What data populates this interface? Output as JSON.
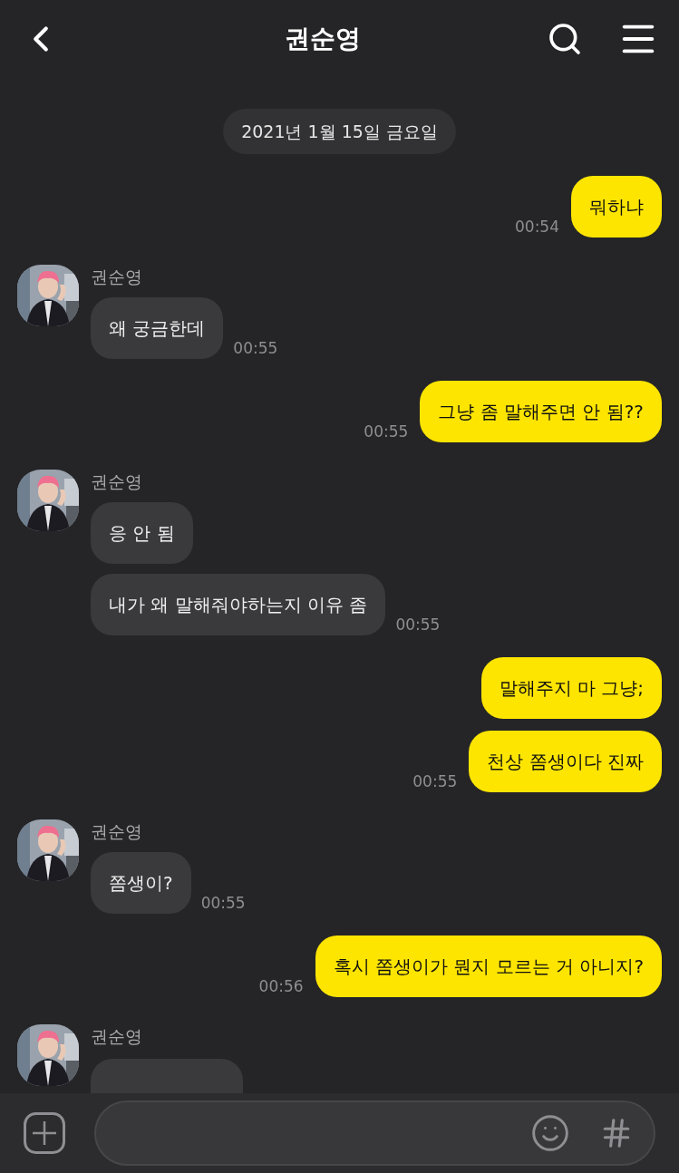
{
  "header": {
    "title": "권순영"
  },
  "messages": [
    {
      "kind": "date",
      "text": "2021년 1월 15일 금요일"
    },
    {
      "kind": "sent",
      "bubbles": [
        "뭐하냐"
      ],
      "time": "00:54"
    },
    {
      "kind": "received",
      "sender": "권순영",
      "bubbles": [
        "왜 궁금한데"
      ],
      "time": "00:55"
    },
    {
      "kind": "sent",
      "bubbles": [
        "그냥 좀 말해주면 안 됨??"
      ],
      "time": "00:55"
    },
    {
      "kind": "received",
      "sender": "권순영",
      "bubbles": [
        "응 안 됨",
        "내가 왜 말해줘야하는지 이유 좀"
      ],
      "time": "00:55"
    },
    {
      "kind": "sent",
      "bubbles": [
        "말해주지 마 그냥;",
        "천상 쫌생이다 진짜"
      ],
      "time": "00:55"
    },
    {
      "kind": "received",
      "sender": "권순영",
      "bubbles": [
        "쫌생이?"
      ],
      "time": "00:55"
    },
    {
      "kind": "sent",
      "bubbles": [
        "혹시 쫌생이가 뭔지 모르는 거 아니지?"
      ],
      "time": "00:56"
    },
    {
      "kind": "received_partial",
      "sender": "권순영"
    }
  ]
}
